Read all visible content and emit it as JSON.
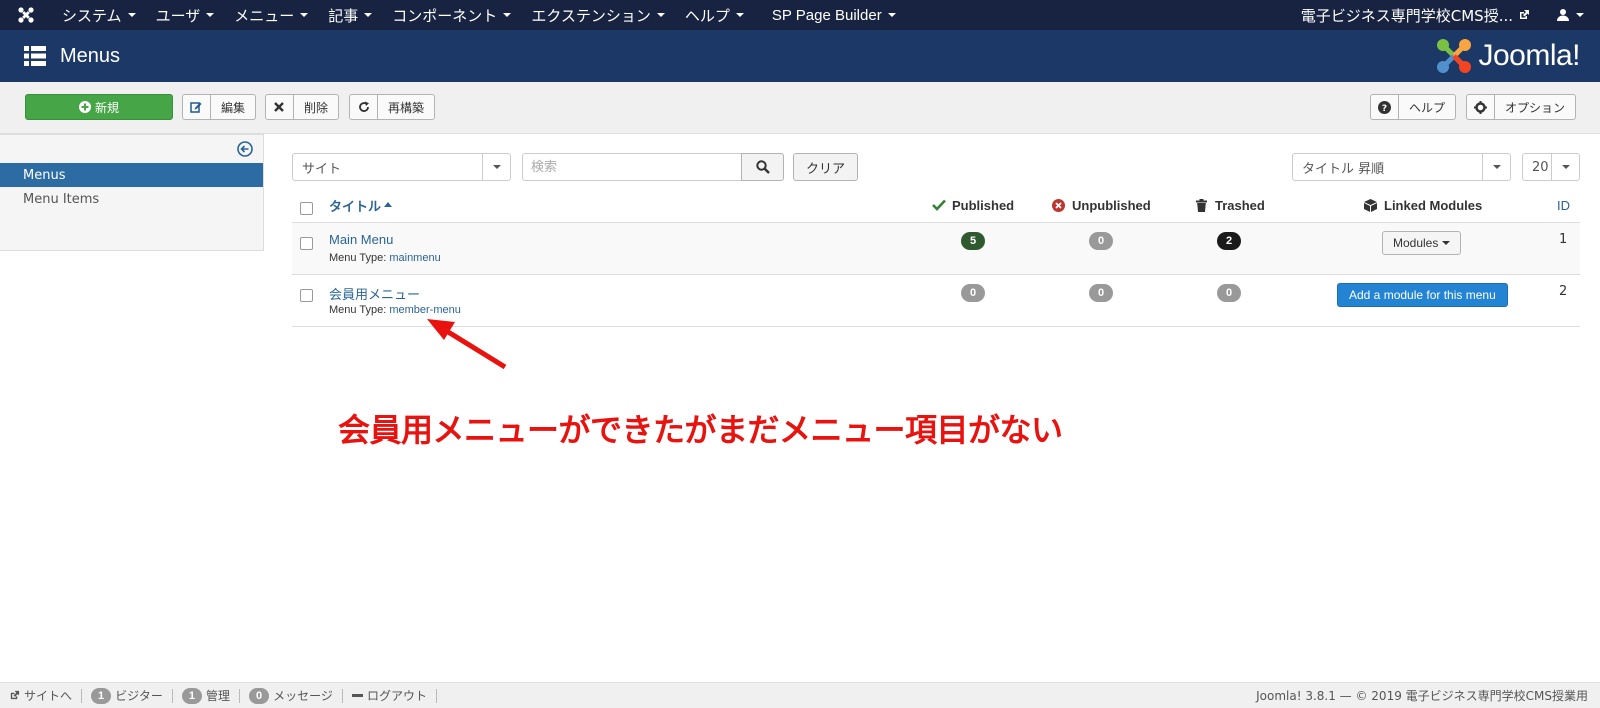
{
  "topnav": {
    "menus": [
      "システム",
      "ユーザ",
      "メニュー",
      "記事",
      "コンポーネント",
      "エクステンション",
      "ヘルプ",
      "SP Page Builder"
    ],
    "site_name": "電子ビジネス専門学校CMS授..."
  },
  "header": {
    "title": "Menus",
    "brand": "Joomla!"
  },
  "toolbar": {
    "new_label": "新規",
    "edit_label": "編集",
    "delete_label": "削除",
    "rebuild_label": "再構築",
    "help_label": "ヘルプ",
    "options_label": "オプション"
  },
  "sidebar": {
    "items": [
      {
        "label": "Menus",
        "active": true
      },
      {
        "label": "Menu Items",
        "active": false
      }
    ]
  },
  "filters": {
    "client": "サイト",
    "search_placeholder": "検索",
    "clear_label": "クリア",
    "sort": "タイトル 昇順",
    "limit": "20"
  },
  "table": {
    "headers": {
      "title": "タイトル",
      "published": "Published",
      "unpublished": "Unpublished",
      "trashed": "Trashed",
      "linked_modules": "Linked Modules",
      "id": "ID"
    },
    "rows": [
      {
        "title": "Main Menu",
        "type_label": "Menu Type:",
        "type": "mainmenu",
        "published": "5",
        "unpublished": "0",
        "trashed": "2",
        "modules_label": "Modules",
        "id": "1"
      },
      {
        "title": "会員用メニュー",
        "type_label": "Menu Type:",
        "type": "member-menu",
        "published": "0",
        "unpublished": "0",
        "trashed": "0",
        "add_module_label": "Add a module for this menu",
        "id": "2"
      }
    ]
  },
  "annotation": {
    "text": "会員用メニューができたがまだメニュー項目がない",
    "color": "#e8120f"
  },
  "footer": {
    "view_site": "サイトへ",
    "visitors_count": "1",
    "visitors_label": "ビジター",
    "admins_count": "1",
    "admins_label": "管理",
    "messages_count": "0",
    "messages_label": "メッセージ",
    "logout_label": "ログアウト",
    "copyright": "Joomla! 3.8.1 — © 2019 電子ビジネス専門学校CMS授業用"
  },
  "colors": {
    "topnav": "#172340",
    "header": "#1b3866",
    "success": "#46a546",
    "badge_published": "#2f5a2f",
    "badge_trashed": "#1a1a1a",
    "badge_zero": "#999999",
    "primary": "#2384d3"
  }
}
